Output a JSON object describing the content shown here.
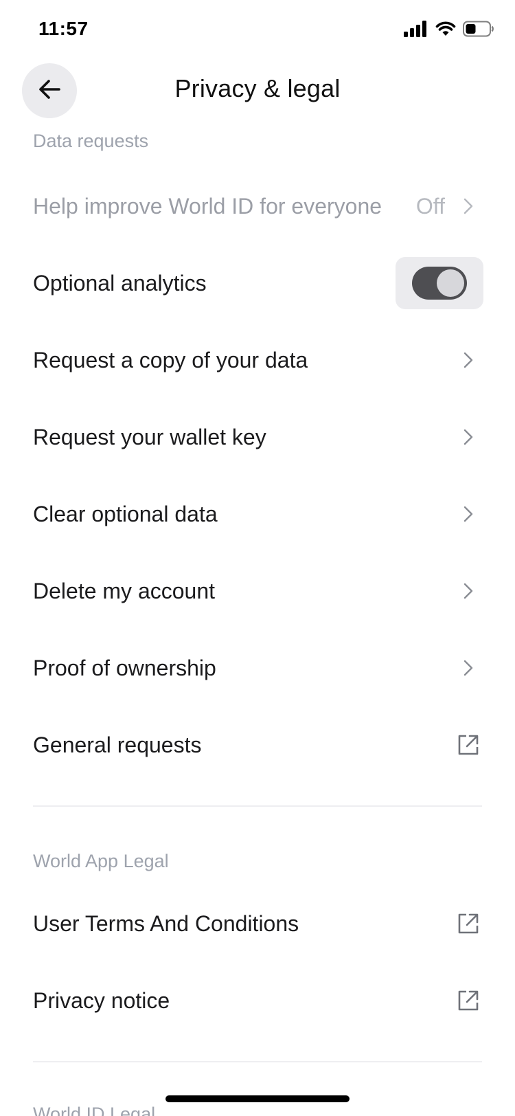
{
  "status_bar": {
    "time": "11:57",
    "icons": [
      "signal-icon",
      "wifi-icon",
      "battery-icon"
    ]
  },
  "header": {
    "title": "Privacy & legal",
    "back_icon": "back-arrow-icon"
  },
  "sections": {
    "data_requests": {
      "title": "Data requests",
      "items": [
        {
          "label": "Help improve World ID for everyone",
          "value": "Off",
          "type": "chevron",
          "muted": true
        },
        {
          "label": "Optional analytics",
          "type": "toggle",
          "toggle_on": true
        },
        {
          "label": "Request a copy of your data",
          "type": "chevron"
        },
        {
          "label": "Request your wallet key",
          "type": "chevron"
        },
        {
          "label": "Clear optional data",
          "type": "chevron"
        },
        {
          "label": "Delete my account",
          "type": "chevron"
        },
        {
          "label": "Proof of ownership",
          "type": "chevron"
        },
        {
          "label": "General requests",
          "type": "external"
        }
      ]
    },
    "world_app_legal": {
      "title": "World App Legal",
      "items": [
        {
          "label": "User Terms And Conditions",
          "type": "external"
        },
        {
          "label": "Privacy notice",
          "type": "external"
        }
      ]
    },
    "world_id_legal": {
      "title": "World ID Legal"
    }
  },
  "colors": {
    "text_primary": "#1b1b1d",
    "text_muted": "#9ea3ad",
    "toggle_track": "#4e4e52",
    "button_bg": "#ebebee"
  }
}
